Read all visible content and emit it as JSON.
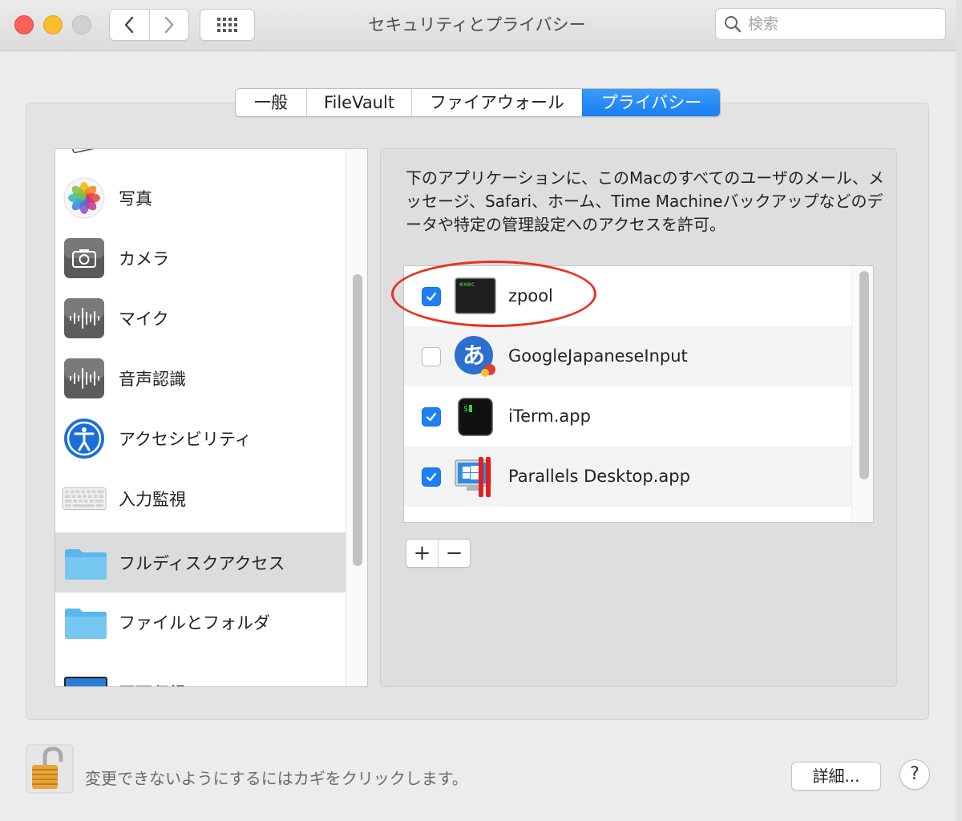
{
  "window": {
    "title": "セキュリティとプライバシー",
    "search_placeholder": "検索"
  },
  "tabs": [
    {
      "label": "一般",
      "active": false
    },
    {
      "label": "FileVault",
      "active": false
    },
    {
      "label": "ファイアウォール",
      "active": false
    },
    {
      "label": "プライバシー",
      "active": true
    }
  ],
  "sidebar": {
    "items": [
      {
        "label": "写真",
        "icon": "photos-icon"
      },
      {
        "label": "カメラ",
        "icon": "camera-icon"
      },
      {
        "label": "マイク",
        "icon": "microphone-icon"
      },
      {
        "label": "音声認識",
        "icon": "speech-recognition-icon"
      },
      {
        "label": "アクセシビリティ",
        "icon": "accessibility-icon"
      },
      {
        "label": "入力監視",
        "icon": "keyboard-icon"
      },
      {
        "label": "フルディスクアクセス",
        "icon": "folder-icon",
        "selected": true
      },
      {
        "label": "ファイルとフォルダ",
        "icon": "folder-icon"
      },
      {
        "label": "画面収録",
        "icon": "screen-icon"
      }
    ]
  },
  "main": {
    "description": "下のアプリケーションに、このMacのすべてのユーザのメール、メッセージ、Safari、ホーム、Time Machineバックアップなどのデータや特定の管理設定へのアクセスを許可。",
    "apps": [
      {
        "name": "zpool",
        "checked": true,
        "icon": "exec-terminal-icon",
        "icon_text": "exec"
      },
      {
        "name": "GoogleJapaneseInput",
        "checked": false,
        "icon": "google-japanese-input-icon",
        "icon_text": "あ"
      },
      {
        "name": "iTerm.app",
        "checked": true,
        "icon": "iterm-icon",
        "icon_text": "$"
      },
      {
        "name": "Parallels Desktop.app",
        "checked": true,
        "icon": "parallels-desktop-icon"
      }
    ],
    "add_label": "+",
    "remove_label": "−"
  },
  "footer": {
    "lock_text": "変更できないようにするにはカギをクリックします。",
    "details_label": "詳細...",
    "help_label": "?"
  },
  "colors": {
    "accent": "#1d7ff3",
    "highlight_oval": "#e8321e"
  }
}
